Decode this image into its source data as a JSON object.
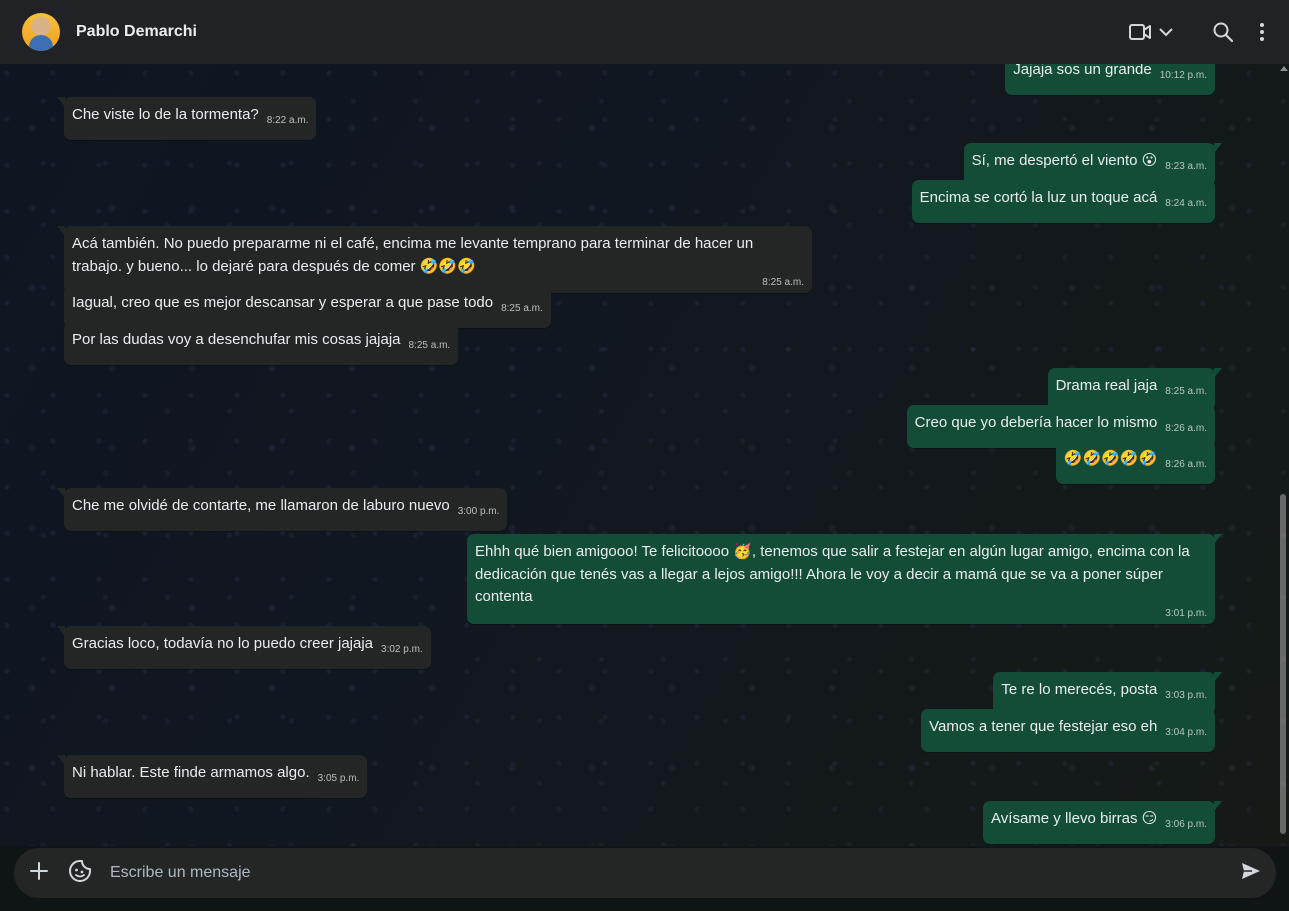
{
  "header": {
    "contact_name": "Pablo Demarchi",
    "icons": {
      "video": "video-call-icon",
      "dropdown": "chevron-down-icon",
      "search": "search-icon",
      "menu": "kebab-menu-icon"
    }
  },
  "messages": [
    {
      "dir": "out",
      "text": "Jajaja sos un grande",
      "time": "10:12 p.m."
    },
    {
      "dir": "in",
      "text": "Che viste lo de la tormenta?",
      "time": "8:22 a.m."
    },
    {
      "dir": "out",
      "text": "Sí, me despertó el viento 😮",
      "time": "8:23 a.m."
    },
    {
      "dir": "out",
      "text": "Encima se cortó la luz un toque acá",
      "time": "8:24 a.m."
    },
    {
      "dir": "in",
      "text": "Acá también. No puedo prepararme ni el café, encima me levante temprano para terminar de hacer un trabajo. y bueno... lo dejaré para después de comer 🤣🤣🤣",
      "time": "8:25 a.m."
    },
    {
      "dir": "in",
      "text": "Iagual, creo que es mejor descansar y esperar a que pase todo",
      "time": "8:25 a.m."
    },
    {
      "dir": "in",
      "text": "Por las dudas voy a desenchufar mis cosas jajaja",
      "time": "8:25 a.m."
    },
    {
      "dir": "out",
      "text": "Drama real jaja",
      "time": "8:25 a.m."
    },
    {
      "dir": "out",
      "text": "Creo que yo debería hacer lo mismo",
      "time": "8:26 a.m."
    },
    {
      "dir": "out",
      "text": "🤣🤣🤣🤣🤣",
      "time": "8:26 a.m."
    },
    {
      "dir": "in",
      "text": "Che me olvidé de contarte, me llamaron de laburo nuevo",
      "time": "3:00 p.m."
    },
    {
      "dir": "out",
      "text": "Ehhh qué bien amigooo! Te felicitoooo 🥳, tenemos que salir a festejar en algún lugar amigo, encima con la dedicación que tenés vas a llegar a lejos amigo!!! Ahora le voy a decir a mamá que se va a poner súper contenta",
      "time": "3:01 p.m."
    },
    {
      "dir": "in",
      "text": "Gracias loco, todavía no lo puedo creer jajaja",
      "time": "3:02 p.m."
    },
    {
      "dir": "out",
      "text": "Te re lo merecés, posta",
      "time": "3:03 p.m."
    },
    {
      "dir": "out",
      "text": "Vamos a tener que festejar eso eh",
      "time": "3:04 p.m."
    },
    {
      "dir": "in",
      "text": "Ni hablar. Este finde armamos algo.",
      "time": "3:05 p.m."
    },
    {
      "dir": "out",
      "text": "Avísame y llevo birras 😏",
      "time": "3:06 p.m."
    }
  ],
  "composer": {
    "placeholder": "Escribe un mensaje",
    "icons": {
      "attach": "plus-icon",
      "sticker": "sticker-icon",
      "send": "send-icon"
    }
  }
}
